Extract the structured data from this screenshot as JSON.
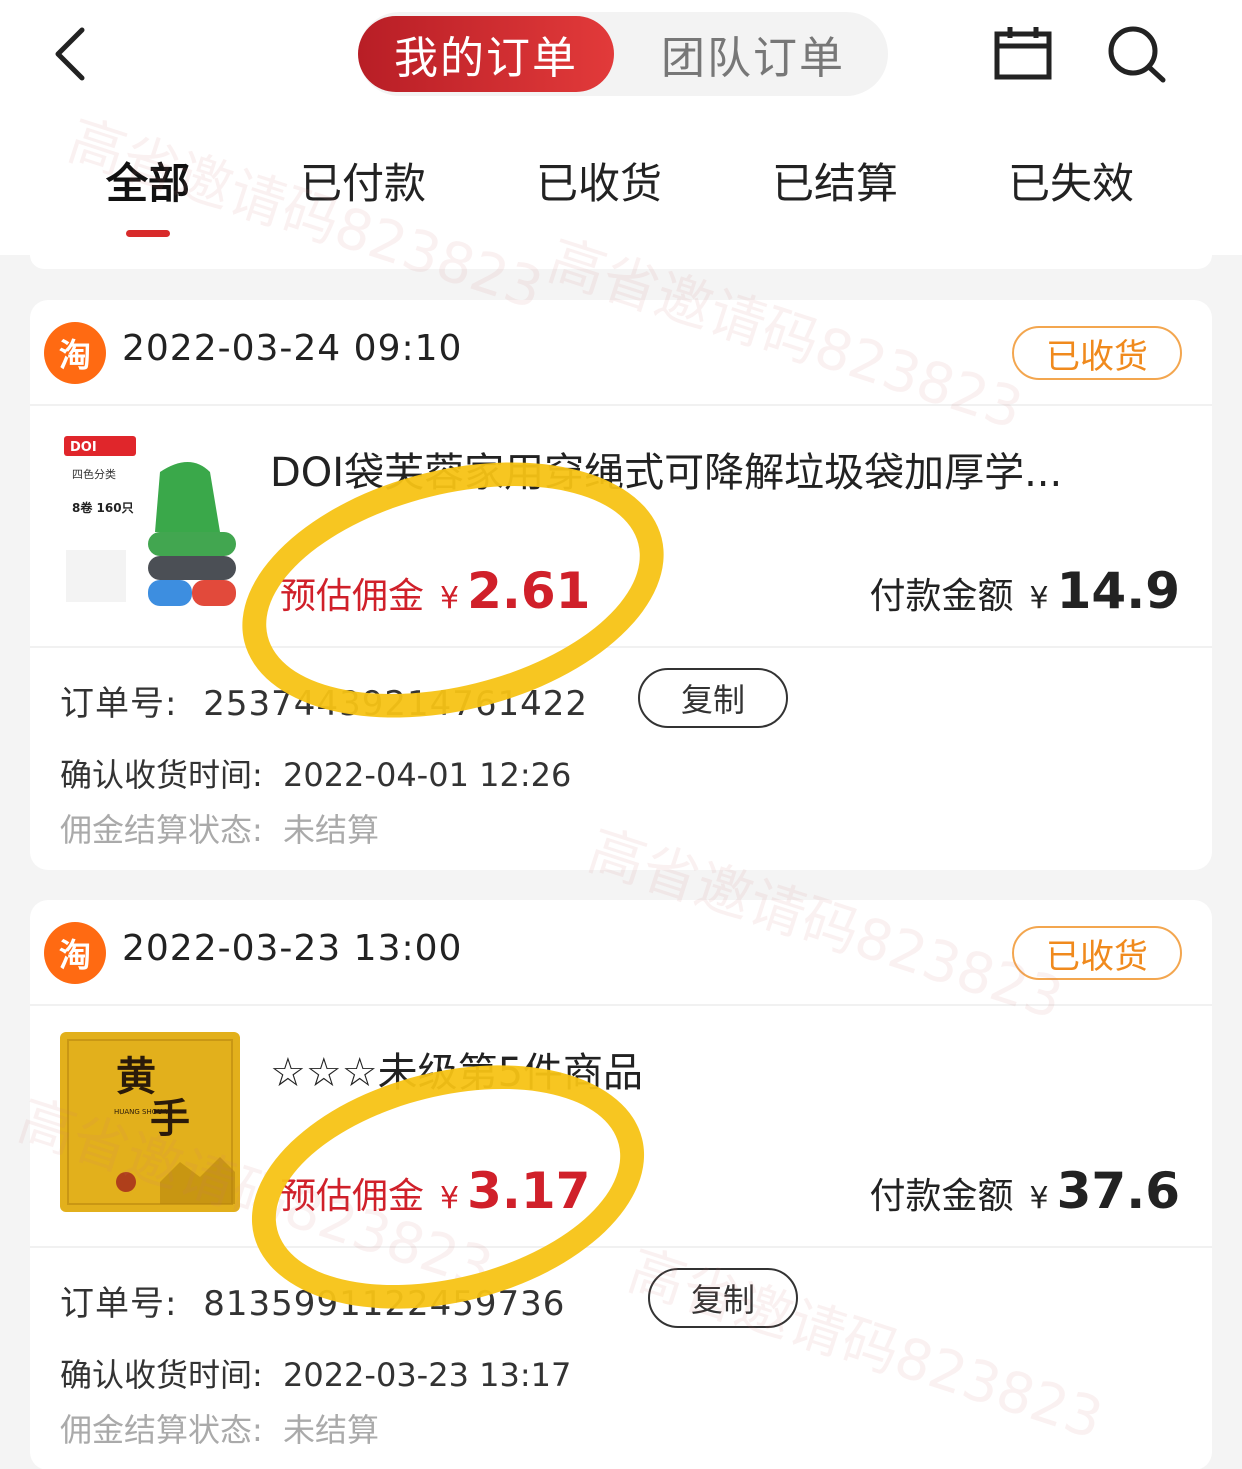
{
  "header": {
    "segments": [
      {
        "label": "我的订单",
        "active": true
      },
      {
        "label": "团队订单",
        "active": false
      }
    ]
  },
  "tabs": [
    "全部",
    "已付款",
    "已收货",
    "已结算",
    "已失效"
  ],
  "active_tab": "全部",
  "orders": [
    {
      "platform_icon_text": "淘",
      "time": "2022-03-24 09:10",
      "status": "已收货",
      "title": "DOI袋芙蓉家用穿绳式可降解垃圾袋加厚学...",
      "commission_label": "预估佣金",
      "currency": "¥",
      "commission": "2.61",
      "paid_label": "付款金额",
      "paid": "14.9",
      "order_no_label": "订单号:",
      "order_no": "25374439214761422",
      "copy_label": "复制",
      "confirm_label": "确认收货时间:",
      "confirm_time": "2022-04-01 12:26",
      "settle_label": "佣金结算状态:",
      "settle_status": "未结算",
      "thumb_text": [
        "DOI",
        "四色分类",
        "8卷 160只"
      ]
    },
    {
      "platform_icon_text": "淘",
      "time": "2022-03-23 13:00",
      "status": "已收货",
      "title": "☆☆☆未级第5件商品",
      "commission_label": "预估佣金",
      "currency": "¥",
      "commission": "3.17",
      "paid_label": "付款金额",
      "paid": "37.6",
      "order_no_label": "订单号:",
      "order_no": "8135991122459736",
      "copy_label": "复制",
      "confirm_label": "确认收货时间:",
      "confirm_time": "2022-03-23 13:17",
      "settle_label": "佣金结算状态:",
      "settle_status": "未结算",
      "thumb_text": [
        "黄",
        "手",
        "HUANG SHOU YI"
      ]
    }
  ],
  "watermark": "高省邀请码823823",
  "colors": {
    "accent_red": "#d0202a",
    "badge_orange": "#f08a1d",
    "taobao_orange": "#ff6a12",
    "highlight_yellow": "#f7c315"
  }
}
